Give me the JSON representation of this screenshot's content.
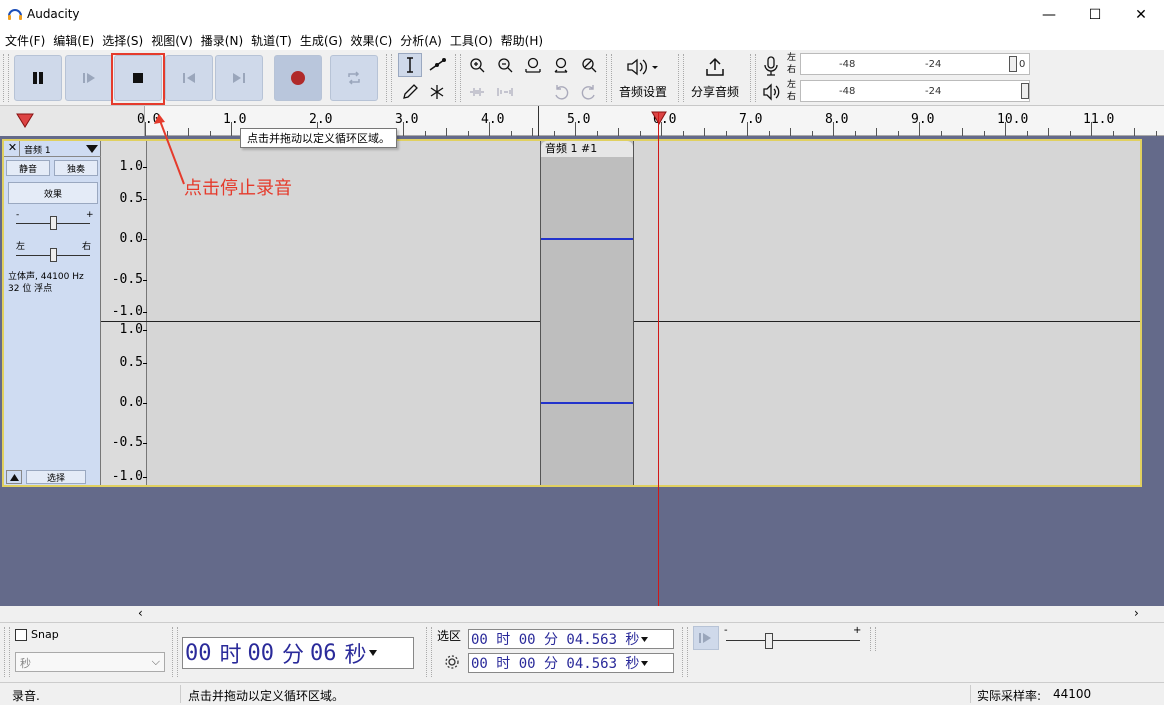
{
  "window": {
    "title": "Audacity",
    "controls": {
      "minimize": "—",
      "maximize": "☐",
      "close": "✕"
    }
  },
  "menu": [
    "文件(F)",
    "编辑(E)",
    "选择(S)",
    "视图(V)",
    "播录(N)",
    "轨道(T)",
    "生成(G)",
    "效果(C)",
    "分析(A)",
    "工具(O)",
    "帮助(H)"
  ],
  "toolbar": {
    "audio_setup_label": "音频设置",
    "share_audio_label": "分享音频",
    "record_meter": {
      "left": "左",
      "right": "右",
      "marks": [
        "-48",
        "-24",
        "0"
      ]
    },
    "play_meter": {
      "left": "左",
      "right": "右",
      "marks": [
        "-48",
        "-24"
      ]
    }
  },
  "ruler": {
    "ticks": [
      "0.0",
      "1.0",
      "2.0",
      "3.0",
      "4.0",
      "5.0",
      "6.0",
      "7.0",
      "8.0",
      "9.0",
      "10.0",
      "11.0"
    ]
  },
  "tooltip": "点击并拖动以定义循环区域。",
  "annotation": "点击停止录音",
  "track": {
    "name": "音频 1",
    "mute": "静音",
    "solo": "独奏",
    "effects": "效果",
    "gain_minus": "-",
    "gain_plus": "+",
    "pan_left": "左",
    "pan_right": "右",
    "info_line1": "立体声, 44100 Hz",
    "info_line2": "32 位 浮点",
    "select": "选择",
    "clip_title": "音频 1 #1",
    "vscale_upper": [
      "1.0",
      "0.5",
      "0.0",
      "-0.5",
      "-1.0"
    ],
    "vscale_lower": [
      "1.0",
      "0.5",
      "0.0",
      "-0.5",
      "-1.0"
    ]
  },
  "bottom": {
    "snap_label": "Snap",
    "snap_unit": "秒",
    "time_display": {
      "h": "00",
      "h_unit": "时",
      "m": "00",
      "m_unit": "分",
      "s": "06",
      "s_unit": "秒"
    },
    "selection_label": "选区",
    "sel_start": "00 时 00 分 04.563 秒",
    "sel_end": "00 时 00 分 04.563 秒",
    "speed_minus": "-",
    "speed_plus": "+"
  },
  "status": {
    "state": "录音.",
    "hint": "点击并拖动以定义循环区域。",
    "rate_label": "实际采样率:",
    "rate_value": "44100"
  },
  "colors": {
    "accent_red": "#e53b2c",
    "track_bg": "#646a8a",
    "waveform": "#2233cc",
    "playhead": "#d01818"
  }
}
